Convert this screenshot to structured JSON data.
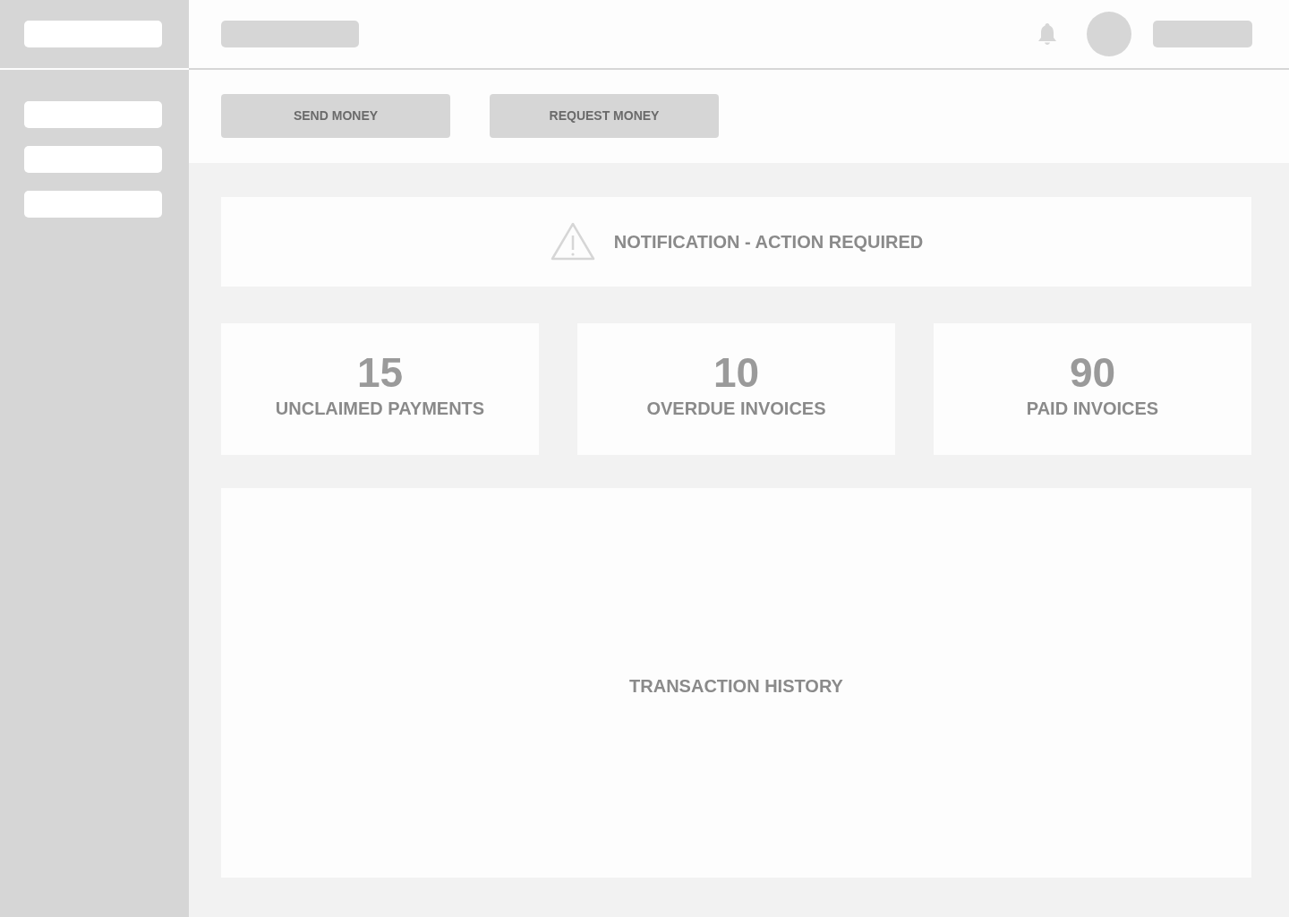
{
  "actions": [
    {
      "label": "SEND MONEY"
    },
    {
      "label": "REQUEST MONEY"
    }
  ],
  "notification": {
    "text": "NOTIFICATION - ACTION REQUIRED"
  },
  "stats": [
    {
      "value": "15",
      "label": "UNCLAIMED PAYMENTS"
    },
    {
      "value": "10",
      "label": "OVERDUE INVOICES"
    },
    {
      "value": "90",
      "label": "PAID INVOICES"
    }
  ],
  "transaction_history": {
    "title": "TRANSACTION HISTORY"
  }
}
